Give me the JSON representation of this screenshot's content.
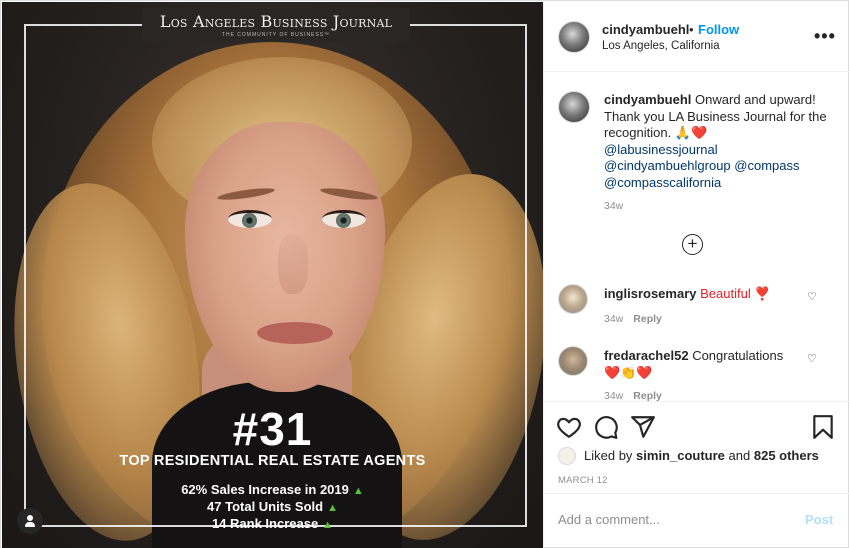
{
  "cover": {
    "masthead": "Los Angeles Business Journal",
    "masthead_sub": "THE COMMUNITY OF BUSINESS™",
    "rank": "#31",
    "rank_title": "TOP RESIDENTIAL REAL ESTATE AGENTS",
    "stats": [
      "62% Sales Increase in 2019",
      "47 Total Units Sold",
      "14 Rank Increase"
    ],
    "up_arrow": "▲",
    "accent_color": "#5bbf3a"
  },
  "header": {
    "username": "cindyambuehl",
    "dot": "•",
    "follow_label": "Follow",
    "location": "Los Angeles, California",
    "more_label": "•••"
  },
  "caption": {
    "username": "cindyambuehl",
    "text": "Onward and upward! Thank you LA Business Journal for the recognition. 🙏❤️",
    "mentions": [
      "@labusinessjournal",
      "@cindyambuehlgroup",
      "@compass",
      "@compasscalifornia"
    ],
    "time": "34w"
  },
  "load_more_label": "+",
  "comments": [
    {
      "username": "inglisrosemary",
      "text": "Beautiful ❣️",
      "time": "34w",
      "reply": "Reply",
      "heart": "♡"
    },
    {
      "username": "fredarachel52",
      "text": "Congratulations",
      "emoji": "❤️👏❤️",
      "time": "34w",
      "reply": "Reply",
      "heart": "♡"
    }
  ],
  "likes": {
    "prefix": "Liked by",
    "user": "simin_couture",
    "middle": "and",
    "others": "825 others"
  },
  "date": "MARCH 12",
  "add_comment": {
    "placeholder": "Add a comment...",
    "post_label": "Post"
  },
  "colors": {
    "link_blue": "#0095f6",
    "mention_blue": "#00376b",
    "muted": "#8e8e8e",
    "post_disabled": "#b2dffc"
  }
}
